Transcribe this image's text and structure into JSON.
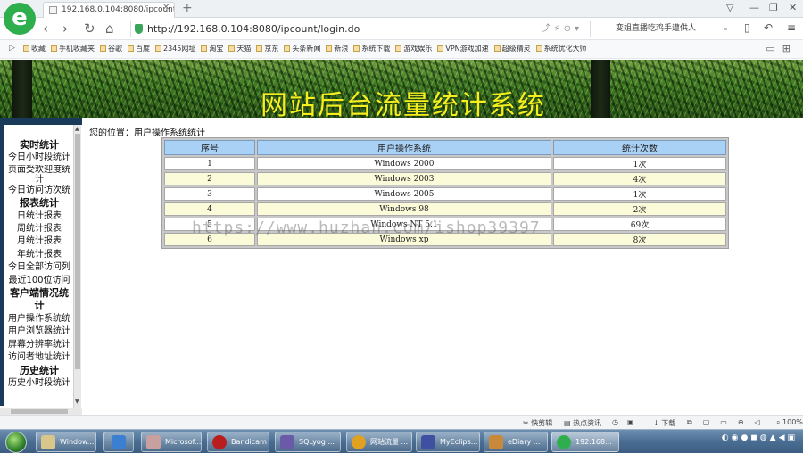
{
  "browser": {
    "tab_title": "192.168.0.104:8080/ipcount/l",
    "url": "http://192.168.0.104:8080/ipcount/login.do",
    "search_text": "变姐直播吃鸡手遭供人",
    "logo_letter": "e",
    "bookmarks": [
      "收藏",
      "手机收藏夹",
      "谷歌",
      "百度",
      "2345网址",
      "淘宝",
      "天猫",
      "京东",
      "头条新闻",
      "新浪",
      "系统下载",
      "游戏娱乐",
      "VPN游戏加速",
      "超级精灵",
      "系统优化大师"
    ]
  },
  "banner": {
    "title": "网站后台流量统计系统"
  },
  "sidebar": {
    "sections": [
      {
        "title": "实时统计",
        "items": [
          "今日小时段统计",
          "页面受欢迎度统计",
          "今日访问访次统"
        ]
      },
      {
        "title": "报表统计",
        "items": [
          "日统计报表",
          "周统计报表",
          "月统计报表",
          "年统计报表",
          "今日全部访问列",
          "最近100位访问"
        ]
      },
      {
        "title": "客户端情况统计",
        "items": [
          "用户操作系统统",
          "用户浏览器统计",
          "屏幕分辨率统计",
          "访问者地址统计"
        ]
      },
      {
        "title": "历史统计",
        "items": [
          "历史小时段统计"
        ]
      }
    ]
  },
  "content": {
    "location_label": "您的位置：用户操作系统统计",
    "table": {
      "headers": [
        "序号",
        "用户操作系统",
        "统计次数"
      ],
      "rows": [
        [
          "1",
          "Windows 2000",
          "1次"
        ],
        [
          "2",
          "Windows 2003",
          "4次"
        ],
        [
          "3",
          "Windows 2005",
          "1次"
        ],
        [
          "4",
          "Windows 98",
          "2次"
        ],
        [
          "5",
          "Windows NT 5.1",
          "69次"
        ],
        [
          "6",
          "Windows xp",
          "8次"
        ]
      ]
    },
    "watermark": "https://www.huzhan.com/ishop39397"
  },
  "statusbar": {
    "left1": "快剪辑",
    "left2": "热点资讯",
    "download": "下载",
    "zoom": "100%"
  },
  "taskbar": {
    "items": [
      {
        "label": "Window...",
        "color": "#d9c68a"
      },
      {
        "label": "",
        "color": "#3a7fd0"
      },
      {
        "label": "Microsof...",
        "color": "#c9a0a0"
      },
      {
        "label": "Bandicam",
        "color": "#b81e1e"
      },
      {
        "label": "SQLyog ...",
        "color": "#6a5aa8"
      },
      {
        "label": "网站流量 ...",
        "color": "#e0a020"
      },
      {
        "label": "MyEclips...",
        "color": "#4050a0"
      },
      {
        "label": "eDiary ...",
        "color": "#c88a3a"
      },
      {
        "label": "192.168...",
        "color": "#2fae4e"
      }
    ]
  }
}
